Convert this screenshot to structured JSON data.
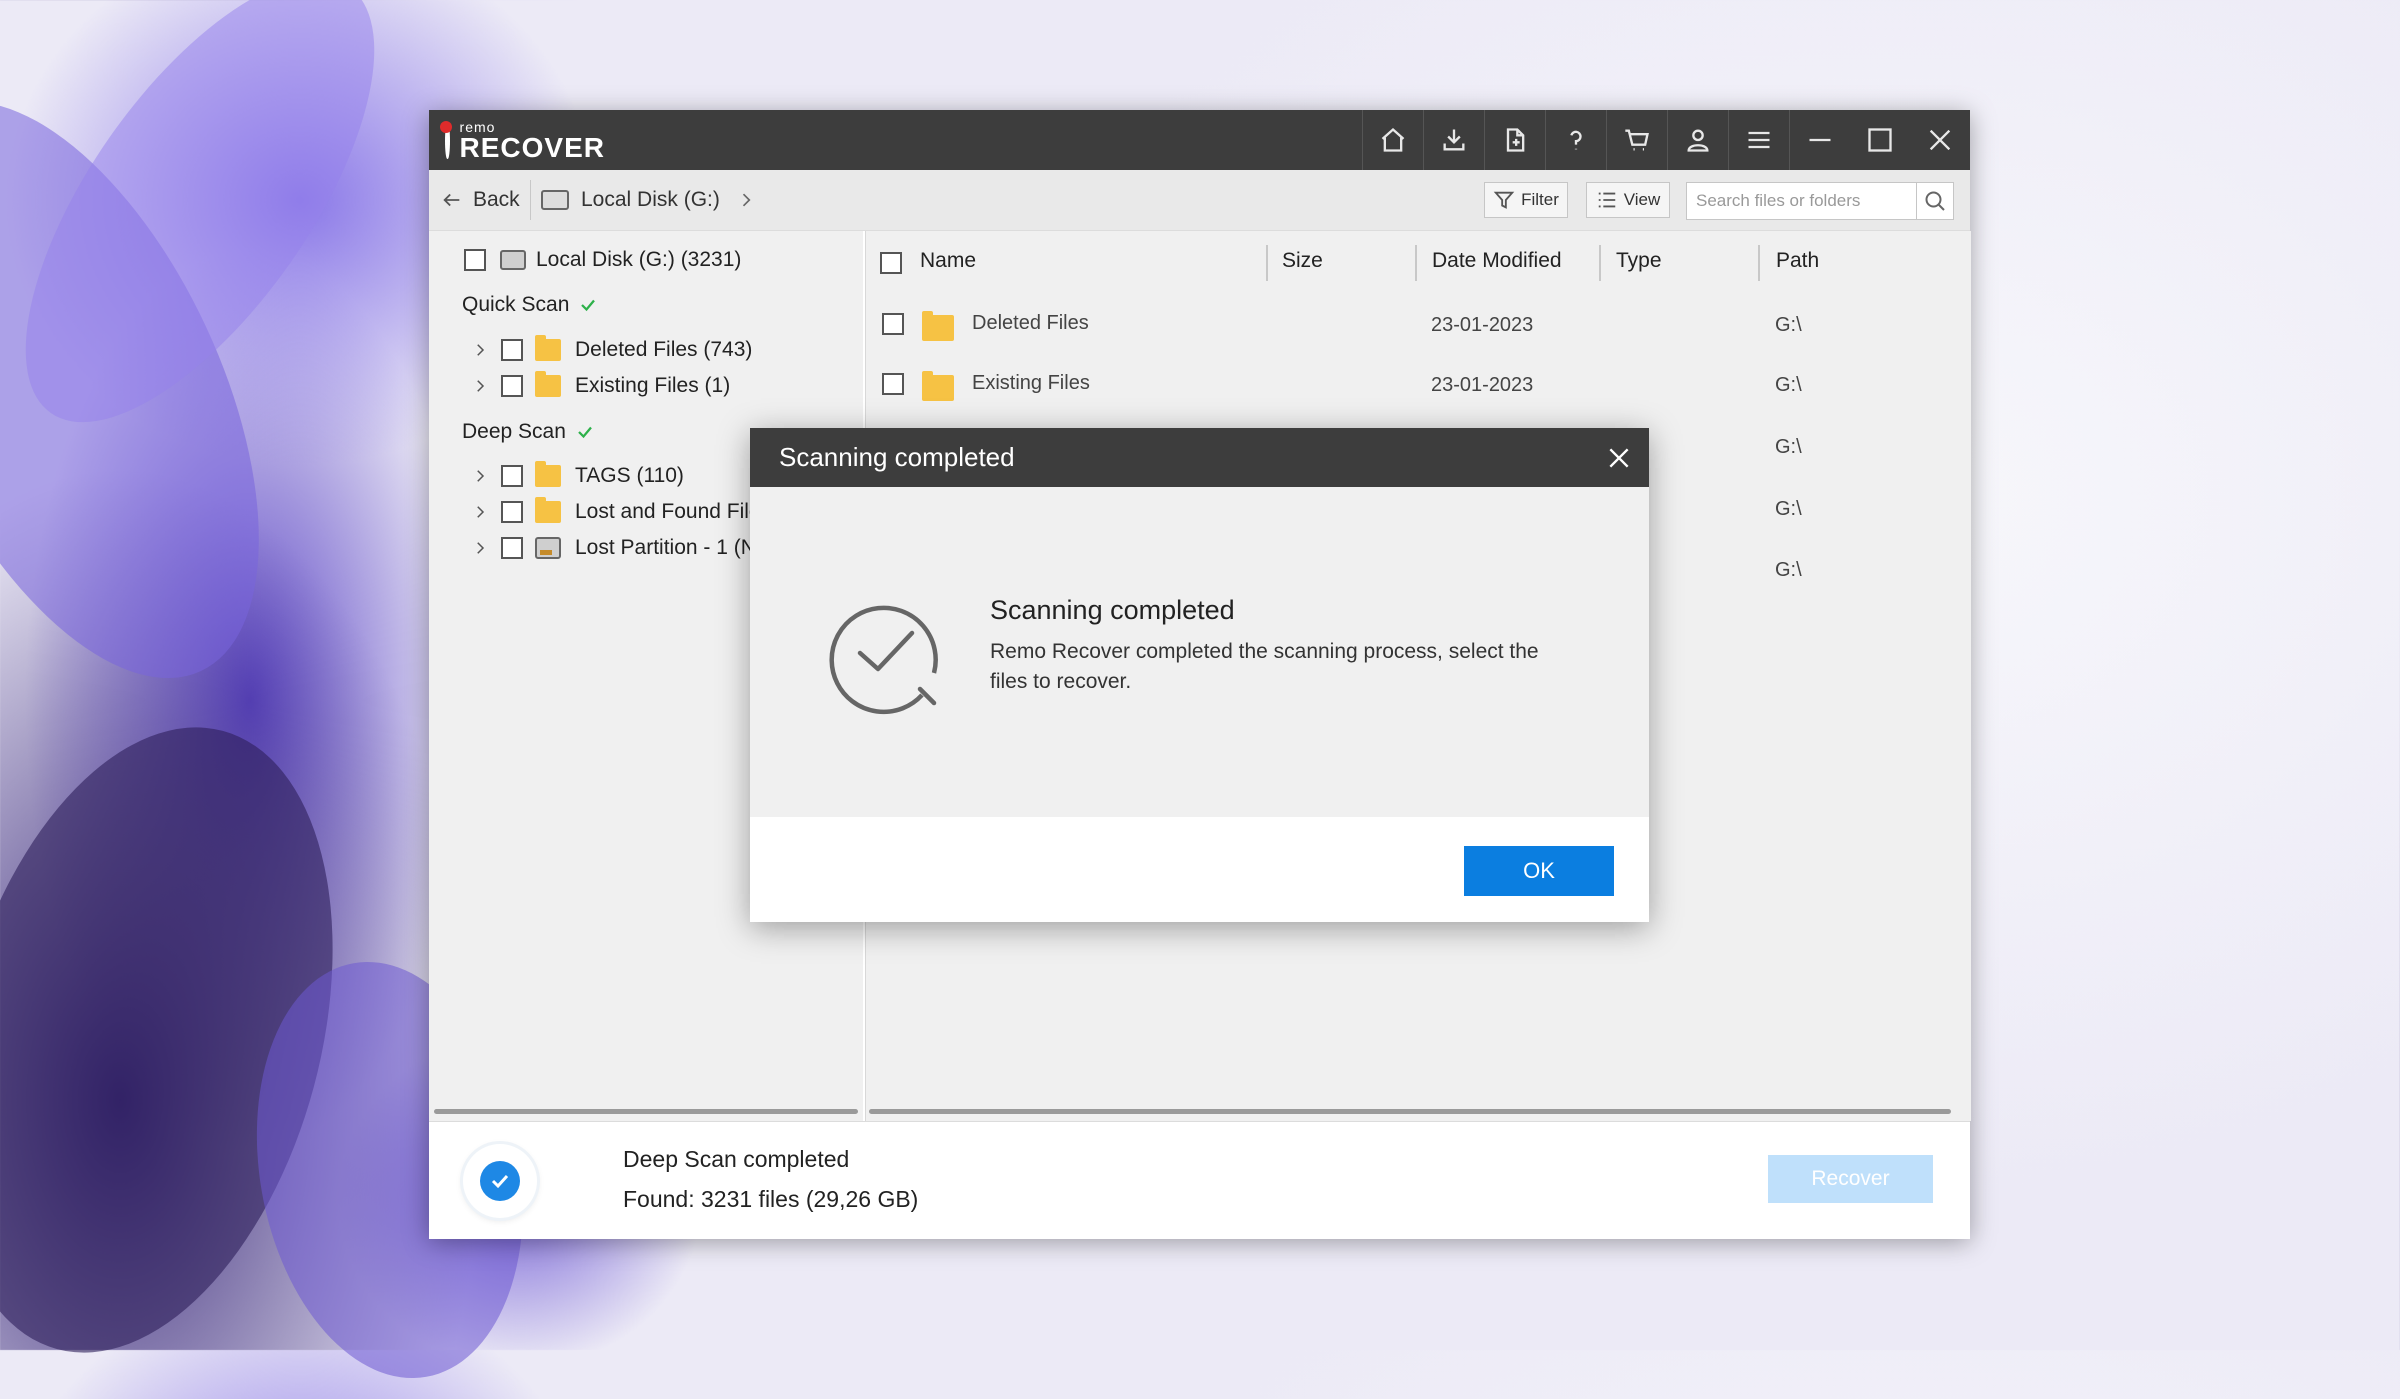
{
  "app": {
    "logo_small": "remo",
    "logo_big": "RECOVER"
  },
  "toolbar": {
    "icons": [
      "home-icon",
      "download-icon",
      "export-icon",
      "help-icon",
      "cart-icon",
      "user-icon",
      "menu-icon",
      "minimize-icon",
      "maximize-icon",
      "close-icon"
    ]
  },
  "nav": {
    "back_label": "Back",
    "crumb_label": "Local Disk (G:)",
    "filter_label": "Filter",
    "view_label": "View",
    "search_placeholder": "Search files or folders"
  },
  "tree": {
    "root_label": "Local Disk (G:) (3231)",
    "quick_scan_label": "Quick Scan",
    "deep_scan_label": "Deep Scan",
    "quick_items": [
      {
        "label": "Deleted Files (743)"
      },
      {
        "label": "Existing Files (1)"
      }
    ],
    "deep_items": [
      {
        "label": "TAGS (110)"
      },
      {
        "label": "Lost and Found Files"
      },
      {
        "label": "Lost Partition - 1 (N"
      }
    ]
  },
  "table": {
    "headers": {
      "name": "Name",
      "size": "Size",
      "date": "Date Modified",
      "type": "Type",
      "path": "Path"
    },
    "rows": [
      {
        "name": "Deleted Files",
        "date": "23-01-2023",
        "path": "G:\\"
      },
      {
        "name": "Existing Files",
        "date": "23-01-2023",
        "path": "G:\\"
      },
      {
        "name": "",
        "date": "",
        "path": "G:\\"
      },
      {
        "name": "",
        "date": "",
        "path": "G:\\"
      },
      {
        "name": "",
        "date": "",
        "path": "G:\\"
      }
    ]
  },
  "status": {
    "title": "Deep Scan completed",
    "found": "Found: 3231 files (29,26 GB)",
    "recover_label": "Recover"
  },
  "dialog": {
    "title": "Scanning completed",
    "heading": "Scanning completed",
    "message": "Remo Recover completed the scanning process, select the files to recover.",
    "ok_label": "OK"
  },
  "colors": {
    "titlebar": "#3d3d3d",
    "accent_blue": "#0b7ee0",
    "folder_yellow": "#f6c244",
    "check_green": "#2db14a",
    "recover_disabled": "#bfe0fb"
  }
}
